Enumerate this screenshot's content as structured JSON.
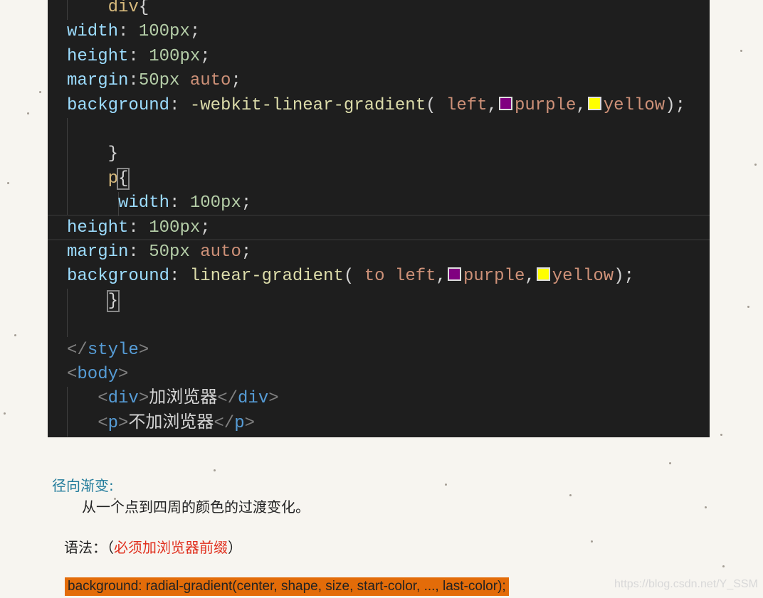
{
  "code_lines": [
    {
      "indent": 4,
      "tokens": [
        [
          "sel",
          "div"
        ],
        [
          "pun",
          "{"
        ]
      ]
    },
    {
      "indent": 0,
      "tokens": [
        [
          "prop",
          "width"
        ],
        [
          "pun",
          ": "
        ],
        [
          "num",
          "100px"
        ],
        [
          "pun",
          ";"
        ]
      ]
    },
    {
      "indent": 0,
      "tokens": [
        [
          "prop",
          "height"
        ],
        [
          "pun",
          ": "
        ],
        [
          "num",
          "100px"
        ],
        [
          "pun",
          ";"
        ]
      ]
    },
    {
      "indent": 0,
      "tokens": [
        [
          "prop",
          "margin"
        ],
        [
          "pun",
          ":"
        ],
        [
          "num",
          "50px"
        ],
        [
          "pun",
          " "
        ],
        [
          "val",
          "auto"
        ],
        [
          "pun",
          ";"
        ]
      ]
    },
    {
      "indent": 0,
      "tokens": [
        [
          "prop",
          "background"
        ],
        [
          "pun",
          ": "
        ],
        [
          "fn",
          "-webkit-linear-gradient"
        ],
        [
          "pun",
          "( "
        ],
        [
          "val",
          "left"
        ],
        [
          "pun",
          ","
        ],
        [
          "sw",
          "#800080"
        ],
        [
          "val",
          "purple"
        ],
        [
          "pun",
          ","
        ],
        [
          "sw",
          "#ffff00"
        ],
        [
          "val",
          "yellow"
        ],
        [
          "pun",
          ");"
        ]
      ]
    },
    {
      "indent": 0,
      "tokens": []
    },
    {
      "indent": 4,
      "tokens": [
        [
          "pun",
          "}"
        ]
      ]
    },
    {
      "indent": 4,
      "tokens": [
        [
          "sel",
          "p"
        ],
        [
          "bracket",
          "{"
        ]
      ]
    },
    {
      "indent": 5,
      "tokens": [
        [
          "prop",
          "width"
        ],
        [
          "pun",
          ": "
        ],
        [
          "num",
          "100px"
        ],
        [
          "pun",
          ";"
        ]
      ]
    },
    {
      "indent": 0,
      "tokens": [
        [
          "prop",
          "height"
        ],
        [
          "pun",
          ": "
        ],
        [
          "num",
          "100px"
        ],
        [
          "pun",
          ";"
        ]
      ]
    },
    {
      "indent": 0,
      "tokens": [
        [
          "prop",
          "margin"
        ],
        [
          "pun",
          ": "
        ],
        [
          "num",
          "50px"
        ],
        [
          "pun",
          " "
        ],
        [
          "val",
          "auto"
        ],
        [
          "pun",
          ";"
        ]
      ]
    },
    {
      "indent": 0,
      "tokens": [
        [
          "prop",
          "background"
        ],
        [
          "pun",
          ": "
        ],
        [
          "fn",
          "linear-gradient"
        ],
        [
          "pun",
          "( "
        ],
        [
          "val",
          "to left"
        ],
        [
          "pun",
          ","
        ],
        [
          "sw",
          "#800080"
        ],
        [
          "val",
          "purple"
        ],
        [
          "pun",
          ","
        ],
        [
          "sw",
          "#ffff00"
        ],
        [
          "val",
          "yellow"
        ],
        [
          "pun",
          ");"
        ]
      ]
    },
    {
      "indent": 4,
      "tokens": [
        [
          "bracket",
          "}"
        ]
      ]
    },
    {
      "indent": 0,
      "tokens": []
    },
    {
      "indent": 0,
      "tokens": [
        [
          "br",
          "</"
        ],
        [
          "tag",
          "style"
        ],
        [
          "br",
          ">"
        ]
      ]
    },
    {
      "indent": 0,
      "tokens": [
        [
          "br",
          "<"
        ],
        [
          "tag",
          "body"
        ],
        [
          "br",
          ">"
        ]
      ]
    },
    {
      "indent": 3,
      "tokens": [
        [
          "br",
          "<"
        ],
        [
          "tag",
          "div"
        ],
        [
          "br",
          ">"
        ],
        [
          "txt",
          "加浏览器"
        ],
        [
          "br",
          "</"
        ],
        [
          "tag",
          "div"
        ],
        [
          "br",
          ">"
        ]
      ]
    },
    {
      "indent": 3,
      "tokens": [
        [
          "br",
          "<"
        ],
        [
          "tag",
          "p"
        ],
        [
          "br",
          ">"
        ],
        [
          "txt",
          "不加浏览器"
        ],
        [
          "br",
          "</"
        ],
        [
          "tag",
          "p"
        ],
        [
          "br",
          ">"
        ]
      ]
    }
  ],
  "article": {
    "heading": "径向渐变:",
    "description": "从一个点到四周的颜色的过渡变化。",
    "syntax_label": "语法：（",
    "syntax_note": "必须加浏览器前缀",
    "syntax_close": "）",
    "syntax_code": "background: radial-gradient(center, shape, size, start-color, ..., last-color);"
  },
  "watermark": "https://blog.csdn.net/Y_SSM",
  "colors": {
    "editor_bg": "#1e1e1e",
    "heading": "#1f7a9a",
    "highlight_bg": "#e36c09",
    "note": "#e0301e"
  }
}
